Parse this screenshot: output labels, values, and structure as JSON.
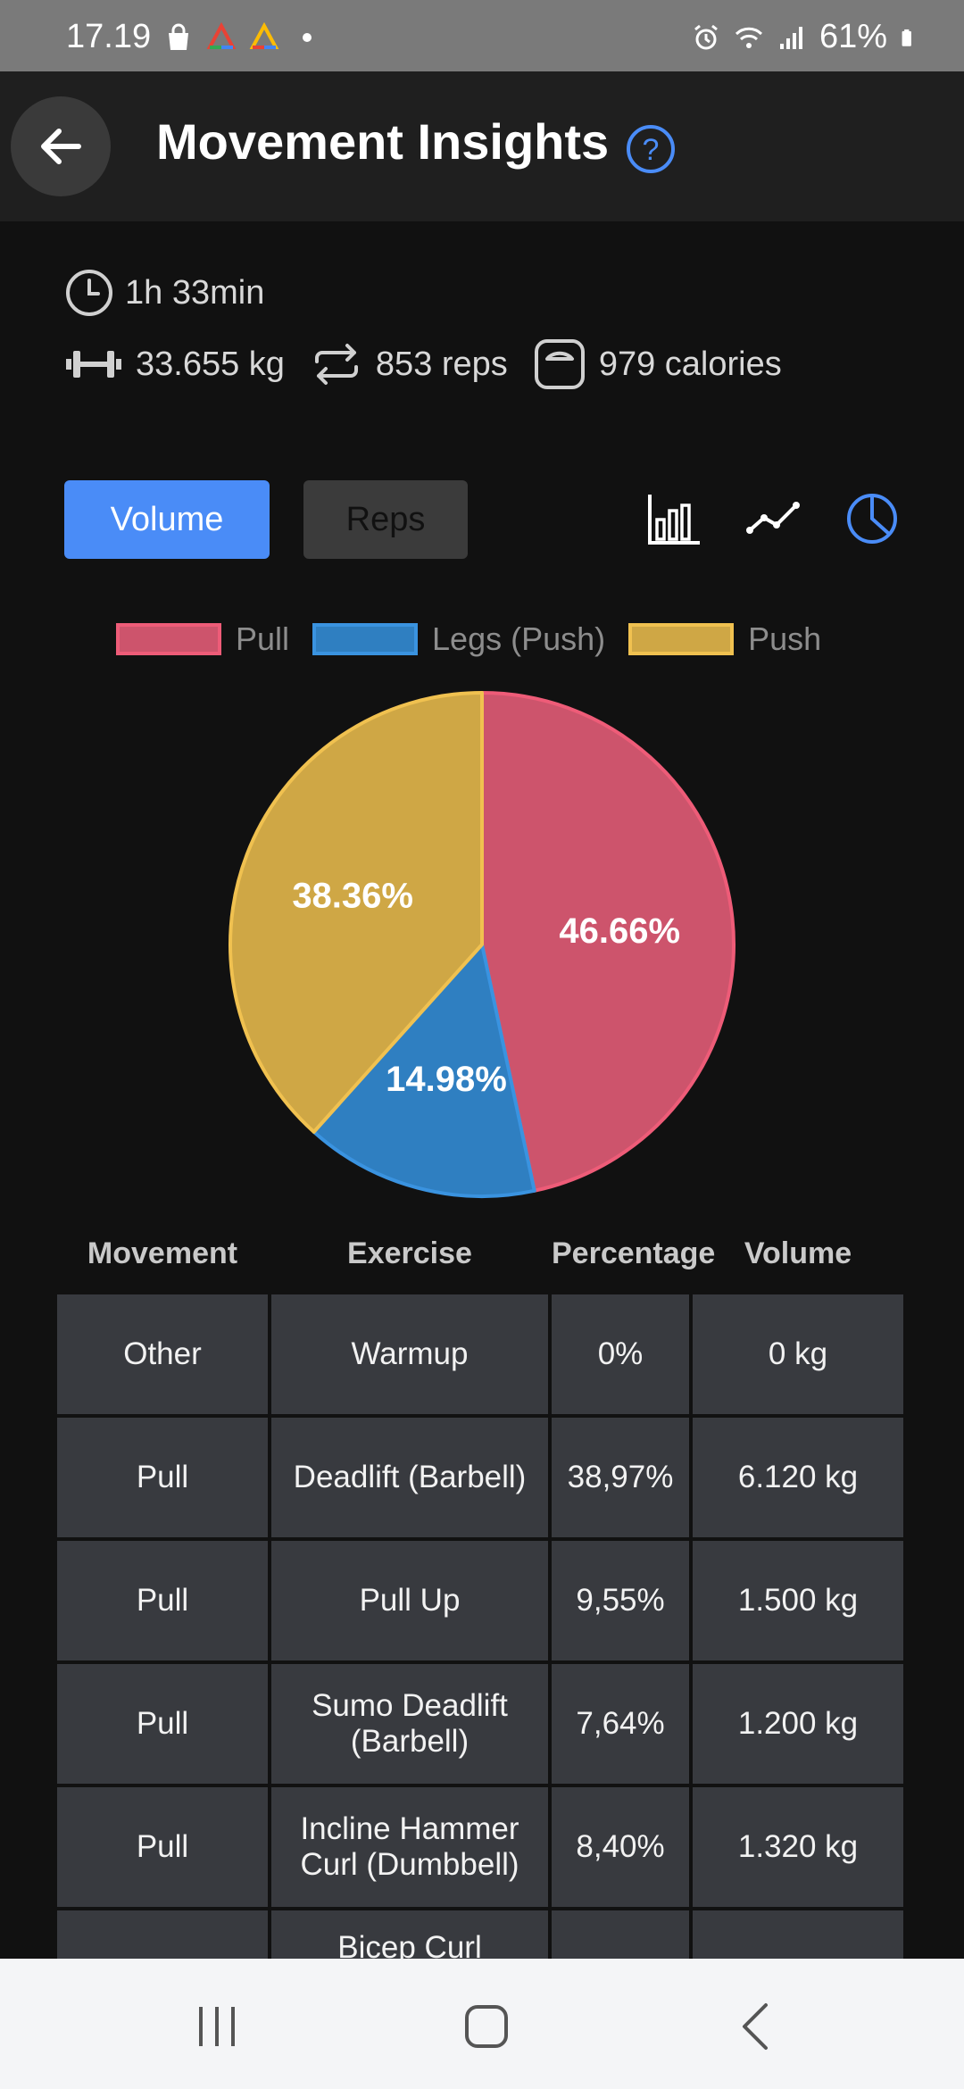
{
  "status_bar": {
    "time": "17.19",
    "battery": "61%"
  },
  "header": {
    "title": "Movement Insights"
  },
  "summary": {
    "duration": "1h 33min",
    "volume": "33.655 kg",
    "reps": "853 reps",
    "calories": "979 calories"
  },
  "tabs": {
    "volume_label": "Volume",
    "reps_label": "Reps",
    "active": "Volume"
  },
  "chart_views": [
    "bar",
    "line",
    "pie"
  ],
  "chart_data": {
    "type": "pie",
    "legend": [
      "Pull",
      "Legs (Push)",
      "Push"
    ],
    "slices": [
      {
        "name": "Pull",
        "value": 46.66,
        "label": "46.66%",
        "color": "#cd546c",
        "border": "#ee5c78"
      },
      {
        "name": "Legs (Push)",
        "value": 14.98,
        "label": "14.98%",
        "color": "#2f7fc1",
        "border": "#3a93e0"
      },
      {
        "name": "Push",
        "value": 38.36,
        "label": "38.36%",
        "color": "#cfa745",
        "border": "#f0c150"
      }
    ]
  },
  "table": {
    "headers": [
      "Movement",
      "Exercise",
      "Percentage",
      "Volume"
    ],
    "rows": [
      {
        "movement": "Other",
        "exercise": "Warmup",
        "percentage": "0%",
        "volume": "0 kg"
      },
      {
        "movement": "Pull",
        "exercise": "Deadlift (Barbell)",
        "percentage": "38,97%",
        "volume": "6.120 kg"
      },
      {
        "movement": "Pull",
        "exercise": "Pull Up",
        "percentage": "9,55%",
        "volume": "1.500 kg"
      },
      {
        "movement": "Pull",
        "exercise": "Sumo Deadlift (Barbell)",
        "percentage": "7,64%",
        "volume": "1.200 kg"
      },
      {
        "movement": "Pull",
        "exercise": "Incline Hammer Curl (Dumbbell)",
        "percentage": "8,40%",
        "volume": "1.320 kg"
      },
      {
        "movement": "",
        "exercise": "Bicep Curl",
        "percentage": "",
        "volume": ""
      }
    ]
  },
  "colors": {
    "accent": "#4a8cf7",
    "background": "#111111",
    "header": "#1f1f1f",
    "cell": "#383a3f"
  }
}
